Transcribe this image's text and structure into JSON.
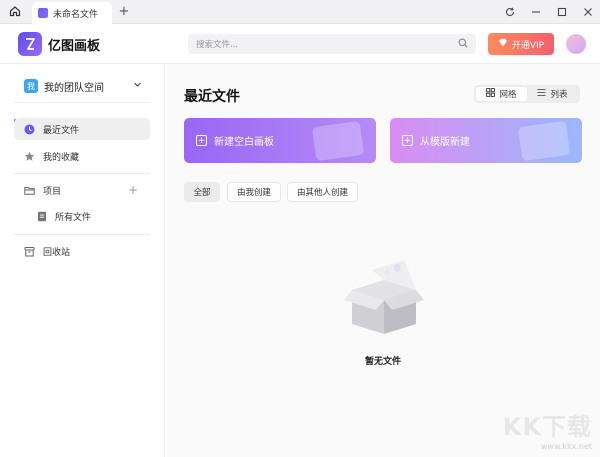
{
  "tabbar": {
    "doc_tab_label": "未命名文件",
    "new_tab_symbol": "+"
  },
  "header": {
    "brand_name": "亿图画板",
    "search_placeholder": "搜索文件...",
    "vip_label": "开通VIP"
  },
  "sidebar": {
    "team_badge": "我",
    "team_name": "我的团队空间",
    "items": [
      {
        "label": "最近文件",
        "icon": "clock-icon",
        "active": true
      },
      {
        "label": "我的收藏",
        "icon": "star-icon"
      },
      {
        "label": "项目",
        "icon": "folder-icon"
      },
      {
        "label": "所有文件",
        "icon": "file-icon"
      },
      {
        "label": "回收站",
        "icon": "trash-icon"
      }
    ],
    "project_add_symbol": "+"
  },
  "main": {
    "title": "最近文件",
    "view_grid": "网格",
    "view_list": "列表",
    "card_blank": "新建空白画板",
    "card_template": "从模版新建",
    "filters": [
      "全部",
      "由我创建",
      "由其他人创建"
    ],
    "empty_text": "暂无文件"
  },
  "watermark": {
    "logo": "KK下载",
    "url": "www.kkx.net"
  },
  "colors": {
    "accent": "#6a5cf6",
    "vip_start": "#ff8b5c",
    "vip_end": "#f25f6f"
  }
}
